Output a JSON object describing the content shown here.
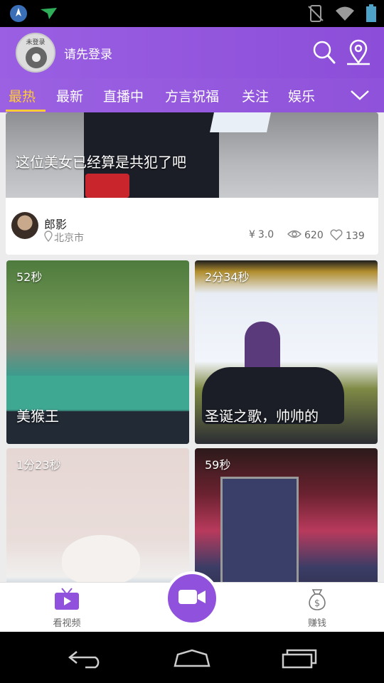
{
  "status_bar": {
    "left_icons": [
      "navigation-app-icon",
      "paper-plane-icon"
    ],
    "right_icons": [
      "no-signal-icon",
      "wifi-icon",
      "battery-icon"
    ]
  },
  "header": {
    "avatar_label": "未登录",
    "login_prompt": "请先登录",
    "icons": [
      "search-icon",
      "location-pin-icon"
    ]
  },
  "tabs": {
    "items": [
      "最热",
      "最新",
      "直播中",
      "方言祝福",
      "关注",
      "娱乐"
    ],
    "active_index": 0,
    "more_icon": "chevron-down-icon"
  },
  "feature": {
    "caption": "这位美女已经算是共犯了吧",
    "author": "郎影",
    "city": "北京市",
    "price": "3.0",
    "views": "620",
    "likes": "139",
    "colors": {
      "stat_text": "#666666",
      "city_text": "#888888"
    }
  },
  "videos": [
    {
      "duration": "52秒",
      "caption": "美猴王"
    },
    {
      "duration": "2分34秒",
      "caption": "圣诞之歌，帅帅的"
    },
    {
      "duration": "1分23秒",
      "caption": ""
    },
    {
      "duration": "59秒",
      "caption": ""
    }
  ],
  "bottom_nav": {
    "watch_label": "看视频",
    "earn_label": "赚钱",
    "center_icon": "video-camera-icon"
  },
  "system_nav": [
    "back-icon",
    "home-icon",
    "recent-apps-icon"
  ],
  "colors": {
    "primary": "#9052dc",
    "active_tab": "#ffcc33",
    "header_bg": "#8c4ed8"
  }
}
